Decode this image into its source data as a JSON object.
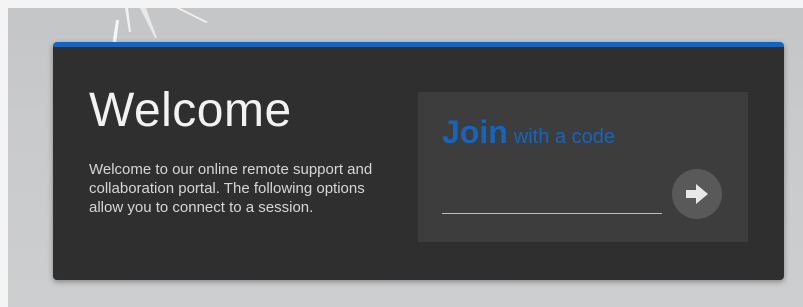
{
  "welcome": {
    "title": "Welcome",
    "description": "Welcome to our online remote support and collaboration portal. The following options allow you to connect to a session."
  },
  "join": {
    "heading_strong": "Join",
    "heading_rest": "with a code",
    "input_value": "",
    "input_placeholder": "",
    "submit_icon": "arrow-right-icon"
  },
  "colors": {
    "accent": "#1565c0",
    "card_background": "#2f2f2f",
    "panel_background": "#3d3d3d",
    "page_background": "#c9cacc",
    "button_background": "#595959"
  }
}
